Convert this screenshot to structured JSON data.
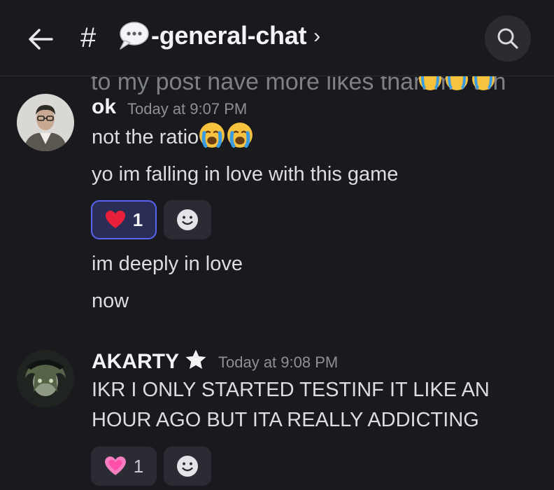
{
  "header": {
    "channel_name": "-general-chat",
    "chevron": "›",
    "hash": "#"
  },
  "cut_message": {
    "text": "to my post have more likes than me tbh"
  },
  "messages": [
    {
      "username": "ok",
      "timestamp": "Today at 9:07 PM",
      "lines": [
        "not the ratio",
        "yo im falling in love with this game",
        "im deeply in love",
        "now"
      ],
      "reaction": {
        "emoji": "red-heart",
        "count": "1"
      }
    },
    {
      "username": "AKARTY",
      "timestamp": "Today at 9:08 PM",
      "lines": [
        "IKR I ONLY STARTED TESTINF IT LIKE AN",
        "HOUR AGO BUT ITA REALLY ADDICTING"
      ],
      "reaction": {
        "emoji": "pink-heart",
        "count": "1"
      }
    }
  ],
  "colors": {
    "background": "#1a1a1e",
    "accent": "#5865f2",
    "reaction_bg": "#2b2c33"
  }
}
